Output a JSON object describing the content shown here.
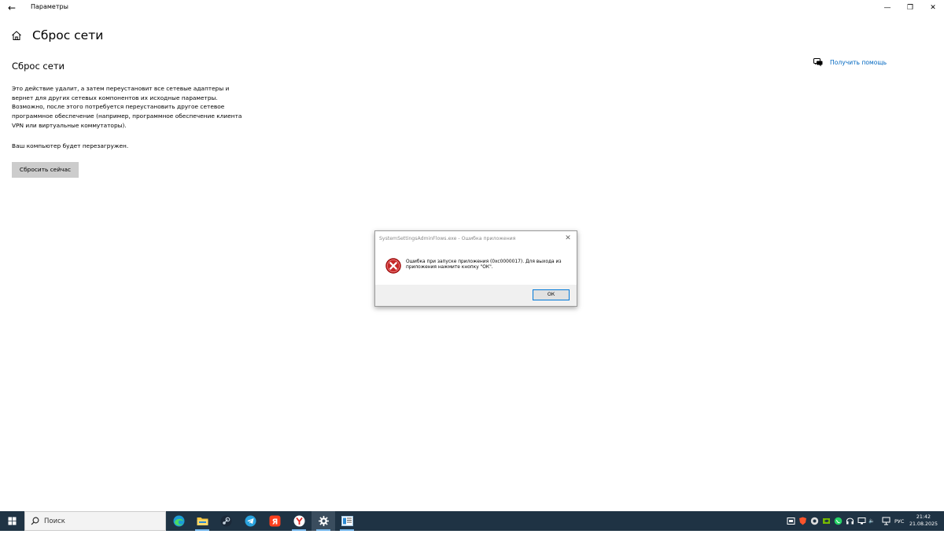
{
  "titlebar": {
    "back_icon": "back-arrow-icon",
    "app_title": "Параметры",
    "minimize_glyph": "—",
    "restore_glyph": "❐",
    "close_glyph": "✕"
  },
  "page": {
    "home_icon": "home-icon",
    "title": "Сброс сети",
    "section_title": "Сброс сети",
    "description": "Это действие удалит, а затем переустановит все сетевые адаптеры и вернет для других сетевых компонентов их исходные параметры. Возможно, после этого потребуется переустановить другое сетевое программное обеспечение (например, программное обеспечение клиента VPN или виртуальные коммутаторы).",
    "reboot_note": "Ваш компьютер будет перезагружен.",
    "reset_button": "Сбросить сейчас",
    "help_link": "Получить помощь"
  },
  "dialog": {
    "title": "SystemSettingsAdminFlows.exe - Ошибка приложения",
    "close_glyph": "✕",
    "icon": "error-icon",
    "message": "Ошибка при запуске приложения (0xc0000017). Для выхода из приложения нажмите кнопку \"ОК\".",
    "ok_button": "ОК"
  },
  "taskbar": {
    "search_placeholder": "Поиск",
    "apps": [
      "edge",
      "file-explorer",
      "steam",
      "telegram",
      "yandex",
      "yandex-browser",
      "settings",
      "notepad"
    ],
    "language": "РУС",
    "time": "21:42",
    "date": "21.08.2025"
  },
  "colors": {
    "accent": "#0067c0",
    "taskbar": "#1f3344",
    "button_gray": "#cccccc",
    "error_red": "#c62828"
  }
}
